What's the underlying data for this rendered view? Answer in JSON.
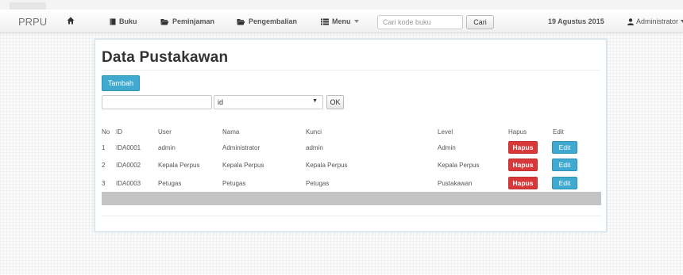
{
  "navbar": {
    "brand": "PRPU",
    "links": [
      {
        "label": "Buku",
        "icon": "book-icon"
      },
      {
        "label": "Peminjaman",
        "icon": "folder-open-icon"
      },
      {
        "label": "Pengembalian",
        "icon": "folder-open-icon"
      },
      {
        "label": "Menu",
        "icon": "list-icon"
      }
    ],
    "search": {
      "value": "",
      "placeholder": "Cari kode buku"
    },
    "search_button": "Cari",
    "date": "19 Agustus 2015",
    "user": "Administrator"
  },
  "page": {
    "title": "Data Pustakawan",
    "add_button": "Tambah",
    "filter": {
      "value": "",
      "selected": "id",
      "submit": "OK"
    }
  },
  "table": {
    "headers": [
      "No",
      "ID",
      "User",
      "Nama",
      "Kunci",
      "Level",
      "Hapus",
      "Edit"
    ],
    "rows": [
      {
        "no": "1",
        "id": "IDA0001",
        "user": "admin",
        "nama": "Administrator",
        "kunci": "admin",
        "level": "Admin"
      },
      {
        "no": "2",
        "id": "IDA0002",
        "user": "Kepala Perpus",
        "nama": "Kepala Perpus",
        "kunci": "Kepala Perpus",
        "level": "Kepala Perpus"
      },
      {
        "no": "3",
        "id": "IDA0003",
        "user": "Petugas",
        "nama": "Petugas",
        "kunci": "Petugas",
        "level": "Pustakawan"
      }
    ],
    "delete_label": "Hapus",
    "edit_label": "Edit"
  },
  "colors": {
    "danger": "#d9383a",
    "info": "#3fa9cf"
  }
}
